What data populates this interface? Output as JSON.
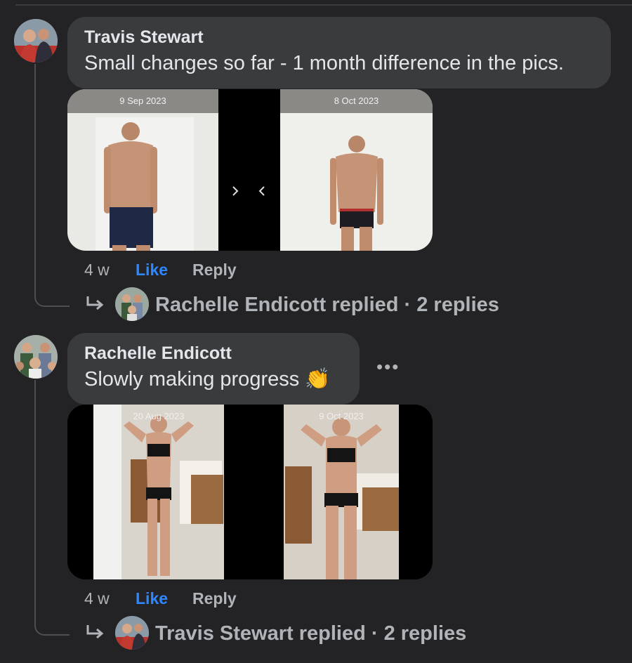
{
  "comments": [
    {
      "author": "Travis Stewart",
      "text": "Small changes so far - 1 month difference in the pics.",
      "photo": {
        "left_date": "9 Sep 2023",
        "right_date": "8 Oct 2023"
      },
      "time": "4 w",
      "like_label": "Like",
      "reply_label": "Reply",
      "replies_summary": "Rachelle Endicott replied · 2 replies"
    },
    {
      "author": "Rachelle Endicott",
      "text": "Slowly making progress 👏",
      "photo": {
        "left_date": "20 Aug 2023",
        "right_date": "9 Oct 2023"
      },
      "time": "4 w",
      "like_label": "Like",
      "reply_label": "Reply",
      "replies_summary": "Travis Stewart replied · 2 replies"
    }
  ],
  "icons": {
    "reply_arrow": "reply-arrow-icon",
    "more": "more-options-icon"
  },
  "colors": {
    "background": "#232325",
    "bubble": "#3a3b3c",
    "like": "#2d88ff",
    "muted": "#b0b3b8"
  }
}
